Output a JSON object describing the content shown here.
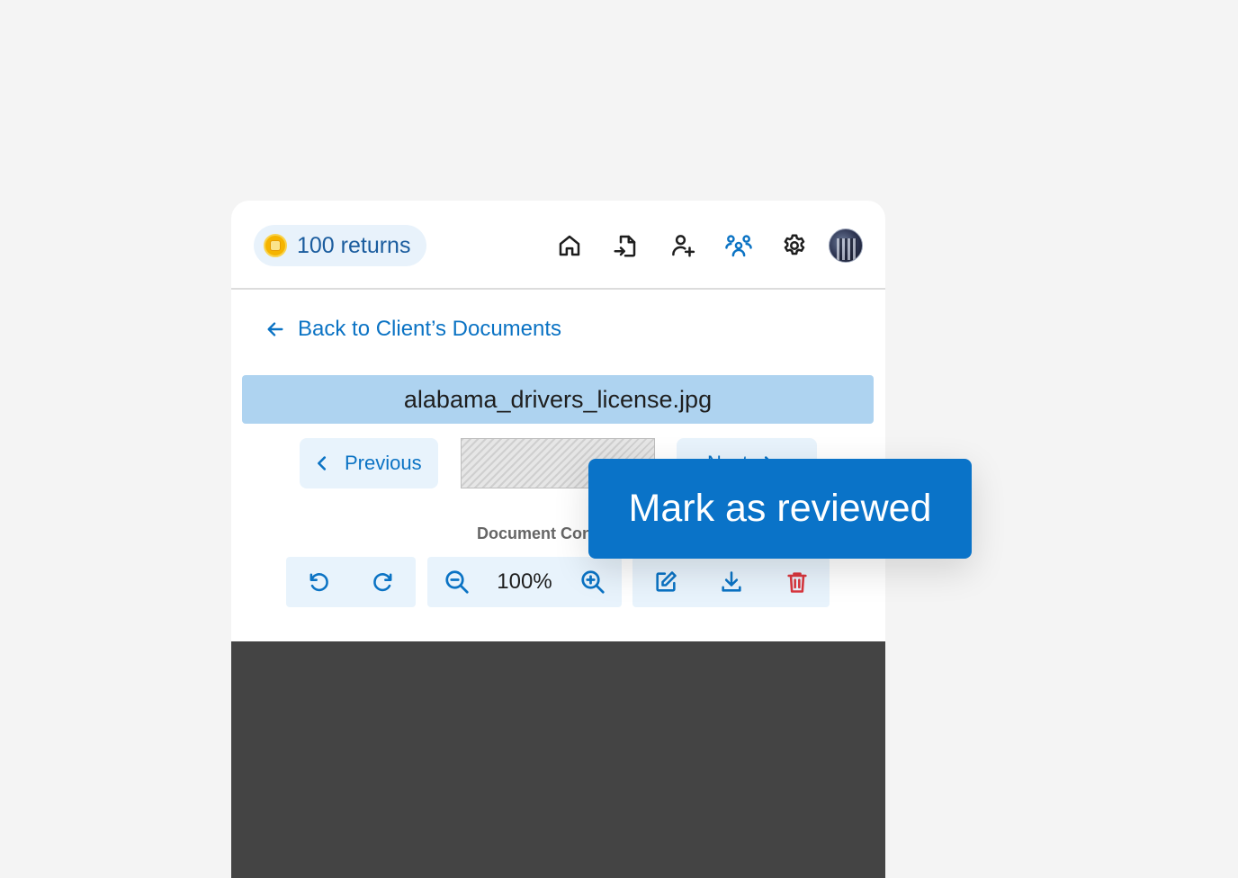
{
  "header": {
    "returns_label": "100 returns",
    "nav_icons": [
      "home-icon",
      "file-import-icon",
      "user-add-icon",
      "users-group-icon",
      "gear-icon",
      "avatar"
    ]
  },
  "back_link": {
    "label": "Back to Client’s Documents"
  },
  "document": {
    "filename": "alabama_drivers_license.jpg"
  },
  "pagination": {
    "previous_label": "Previous",
    "next_label": "Next"
  },
  "controls": {
    "label": "Document Controls",
    "zoom_value": "100%",
    "icons": [
      "rotate-left-icon",
      "rotate-right-icon",
      "zoom-out-icon",
      "zoom-in-icon",
      "edit-icon",
      "download-icon",
      "trash-icon"
    ]
  },
  "overlay_button": {
    "label": "Mark as reviewed"
  },
  "colors": {
    "accent": "#0b73c4",
    "primary_button": "#0a73c8",
    "filename_bar": "#aed3f0",
    "danger": "#d9363e",
    "viewer_bg": "#444444",
    "soft_blue": "#e8f3fc"
  }
}
